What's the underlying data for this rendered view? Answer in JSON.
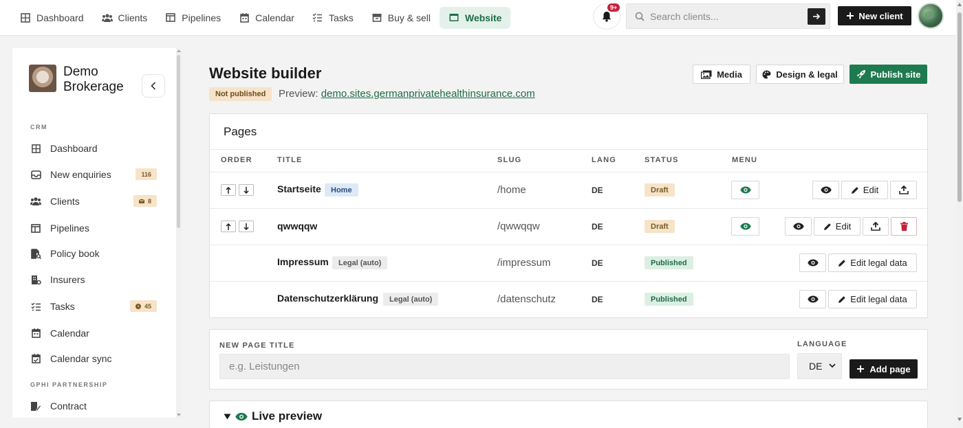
{
  "topnav": {
    "items": [
      {
        "label": "Dashboard",
        "icon": "grid-icon"
      },
      {
        "label": "Clients",
        "icon": "users-icon"
      },
      {
        "label": "Pipelines",
        "icon": "columns-icon"
      },
      {
        "label": "Calendar",
        "icon": "calendar-icon"
      },
      {
        "label": "Tasks",
        "icon": "checklist-icon"
      },
      {
        "label": "Buy & sell",
        "icon": "box-icon"
      },
      {
        "label": "Website",
        "icon": "window-icon",
        "active": true
      }
    ],
    "notifications_badge": "9+",
    "search_placeholder": "Search clients...",
    "new_client_label": "New client"
  },
  "sidebar": {
    "brand_line1": "Demo",
    "brand_line2": "Brokerage",
    "sections": [
      {
        "label": "CRM"
      },
      {
        "label": "GPHI PARTNERSHIP"
      }
    ],
    "items": [
      {
        "label": "Dashboard",
        "icon": "grid-icon"
      },
      {
        "label": "New enquiries",
        "icon": "inbox-icon",
        "badge": "116"
      },
      {
        "label": "Clients",
        "icon": "users-icon",
        "badge": "8",
        "badge_icon": "mail-icon"
      },
      {
        "label": "Pipelines",
        "icon": "columns-icon"
      },
      {
        "label": "Policy book",
        "icon": "file-search-icon"
      },
      {
        "label": "Insurers",
        "icon": "building-icon"
      },
      {
        "label": "Tasks",
        "icon": "checklist-icon",
        "badge": "45",
        "badge_icon": "clock-icon"
      },
      {
        "label": "Calendar",
        "icon": "calendar-icon"
      },
      {
        "label": "Calendar sync",
        "icon": "calendar-check-icon"
      },
      {
        "label": "Contract",
        "icon": "file-signature-icon"
      }
    ]
  },
  "header": {
    "title": "Website builder",
    "status": "Not published",
    "preview_label": "Preview:",
    "preview_url": "demo.sites.germanprivatehealthinsurance.com",
    "media_label": "Media",
    "design_label": "Design & legal",
    "publish_label": "Publish site"
  },
  "pages": {
    "title": "Pages",
    "columns": [
      "ORDER",
      "TITLE",
      "SLUG",
      "LANG",
      "STATUS",
      "MENU"
    ],
    "rows": [
      {
        "title": "Startseite",
        "tag": "Home",
        "slug": "/home",
        "lang": "DE",
        "status": "Draft",
        "edit_label": "Edit"
      },
      {
        "title": "qwwqqw",
        "tag": "",
        "slug": "/qwwqqw",
        "lang": "DE",
        "status": "Draft",
        "edit_label": "Edit"
      },
      {
        "title": "Impressum",
        "tag": "Legal (auto)",
        "slug": "/impressum",
        "lang": "DE",
        "status": "Published",
        "edit_label": "Edit legal data"
      },
      {
        "title": "Datenschutzerklärung",
        "tag": "Legal (auto)",
        "slug": "/datenschutz",
        "lang": "DE",
        "status": "Published",
        "edit_label": "Edit legal data"
      }
    ]
  },
  "new_page": {
    "title_label": "NEW PAGE TITLE",
    "title_placeholder": "e.g. Leistungen",
    "language_label": "LANGUAGE",
    "language_value": "DE",
    "add_label": "Add page"
  },
  "live_preview": {
    "label": "Live preview"
  },
  "colors": {
    "accent": "#1f7a4f",
    "draft": "#f6e3c8",
    "published": "#dcefe3",
    "home_tag": "#dde9f6"
  }
}
